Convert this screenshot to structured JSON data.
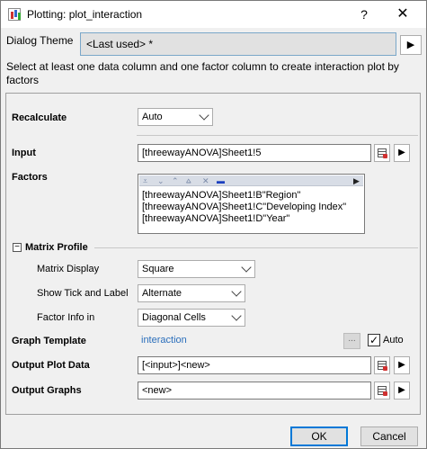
{
  "window": {
    "title": "Plotting: plot_interaction",
    "help_label": "?",
    "close_label": "✕"
  },
  "theme": {
    "label": "Dialog Theme",
    "value": "<Last used> *",
    "arrow": "▶"
  },
  "instruction": "Select at least one data column and one factor column to create interaction plot by factors",
  "recalculate": {
    "label": "Recalculate",
    "value": "Auto"
  },
  "input": {
    "label": "Input",
    "value": "[threewayANOVA]Sheet1!5",
    "arrow": "▶"
  },
  "factors": {
    "label": "Factors",
    "toolbar_icons": [
      "⩡",
      "⌄",
      "⌃",
      "⩠",
      "✕",
      "▬",
      "▶"
    ],
    "items": [
      "[threewayANOVA]Sheet1!B\"Region\"",
      "[threewayANOVA]Sheet1!C\"Developing Index\"",
      "[threewayANOVA]Sheet1!D\"Year\""
    ]
  },
  "matrix_profile": {
    "toggle": "−",
    "label": "Matrix Profile",
    "display": {
      "label": "Matrix Display",
      "value": "Square"
    },
    "tick": {
      "label": "Show Tick and Label",
      "value": "Alternate"
    },
    "factor_info": {
      "label": "Factor Info in",
      "value": "Diagonal Cells"
    }
  },
  "graph_template": {
    "label": "Graph Template",
    "value": "interaction",
    "browse": "...",
    "auto_label": "Auto",
    "auto_checked": "✓"
  },
  "output_plot_data": {
    "label": "Output Plot Data",
    "value": "[<input>]<new>",
    "arrow": "▶"
  },
  "output_graphs": {
    "label": "Output Graphs",
    "value": "<new>",
    "arrow": "▶"
  },
  "buttons": {
    "ok": "OK",
    "cancel": "Cancel"
  }
}
